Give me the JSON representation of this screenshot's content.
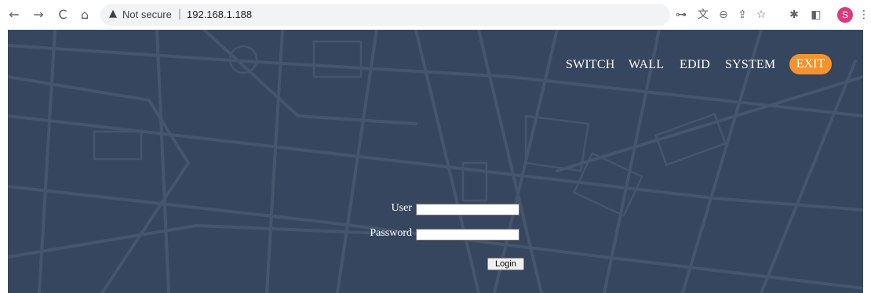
{
  "browser": {
    "nav": {
      "back_icon": "←",
      "forward_icon": "→",
      "reload_icon": "C",
      "home_icon": "⌂"
    },
    "omnibox": {
      "warning_icon": "▲",
      "security_label": "Not secure",
      "separator": "|",
      "url": "192.168.1.188"
    },
    "toolbar_icons": {
      "key": "⊶",
      "translate": "文",
      "zoom": "⊖",
      "share": "⇪",
      "bookmark": "☆",
      "extensions": "✱",
      "side_panel": "◧",
      "menu": "⋮"
    },
    "profile_initial": "S",
    "colors": {
      "avatar": "#d93b7c",
      "omnibox_bg": "#f1f3f4"
    }
  },
  "nav": {
    "switch": "SWITCH",
    "wall": "WALL",
    "edid": "EDID",
    "system": "SYSTEM",
    "exit": "EXIT"
  },
  "login": {
    "user_label": "User",
    "user_value": "",
    "password_label": "Password",
    "password_value": "",
    "login_button": "Login"
  },
  "colors": {
    "page_bg": "#36465e",
    "map_lines": "#45556c",
    "exit_accent": "#f5922b"
  }
}
